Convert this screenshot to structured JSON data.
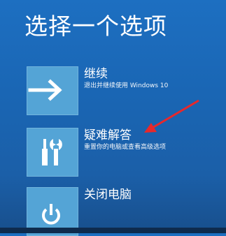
{
  "title": "选择一个选项",
  "options": [
    {
      "label": "继续",
      "description": "退出并继续使用 Windows 10",
      "icon": "arrow-right-icon"
    },
    {
      "label": "疑难解答",
      "description": "重置你的电脑或查看高级选项",
      "icon": "tools-icon"
    },
    {
      "label": "关闭电脑",
      "description": "",
      "icon": "power-icon"
    }
  ],
  "colors": {
    "background": "#1b66b4",
    "tile": "#54a4d6",
    "annotation_arrow": "#e8282b"
  }
}
